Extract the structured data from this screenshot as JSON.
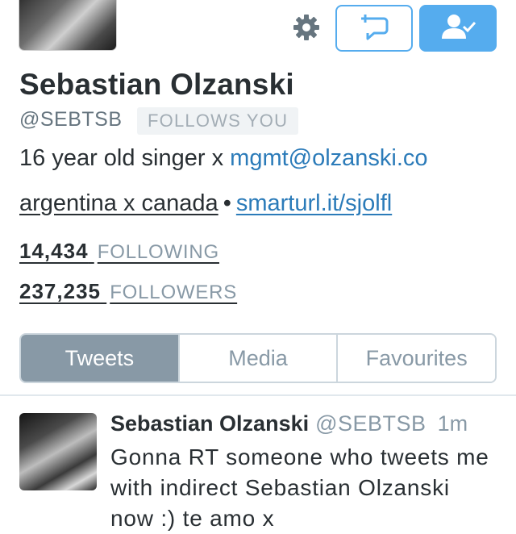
{
  "profile": {
    "name": "Sebastian Olzanski",
    "handle": "@SEBTSB",
    "follows_you": "FOLLOWS YOU",
    "bio_text": "16 year old singer x ",
    "bio_link": "mgmt@olzanski.co",
    "location": "argentina x canada",
    "separator": "•",
    "website": "smarturl.it/sjolfl"
  },
  "stats": {
    "following_count": "14,434",
    "following_label": "FOLLOWING",
    "followers_count": "237,235",
    "followers_label": "FOLLOWERS"
  },
  "tabs": [
    {
      "label": "Tweets",
      "active": true
    },
    {
      "label": "Media",
      "active": false
    },
    {
      "label": "Favourites",
      "active": false
    }
  ],
  "tweet": {
    "name": "Sebastian Olzanski",
    "handle": "@SEBTSB",
    "time": "1m",
    "text": "Gonna RT someone who tweets me with indirect Sebastian Olzanski now :) te amo x"
  },
  "icons": {
    "settings": "gear-icon",
    "tweet_to": "tweet-compose-icon",
    "following": "user-check-icon"
  },
  "colors": {
    "accent": "#55acee",
    "link": "#2b7bb9",
    "muted": "#8899a6"
  }
}
